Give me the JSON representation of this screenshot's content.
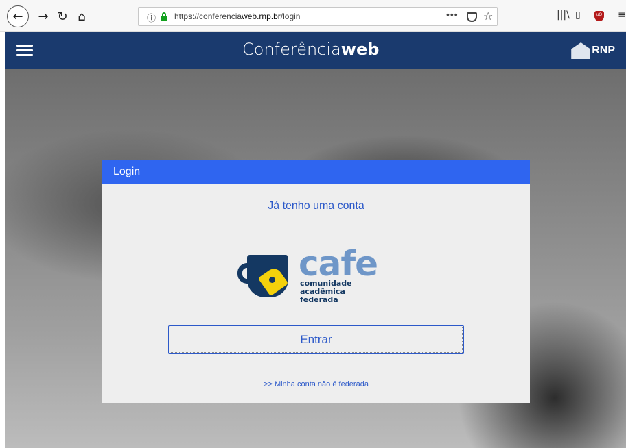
{
  "browser": {
    "url_prefix": "https://conferencia",
    "url_host": "web.rnp.br",
    "url_path": "/login",
    "more_label": "•••"
  },
  "header": {
    "brand_light": "Conferência",
    "brand_bold": "web",
    "org": "RNP",
    "color": "#1a3a6e"
  },
  "login": {
    "title": "Login",
    "subtitle": "Já tenho uma conta",
    "cafe_word": "cafe",
    "cafe_line1": "comunidade",
    "cafe_line2": "acadêmica federada",
    "button": "Entrar",
    "link": ">> Minha conta não é federada",
    "accent": "#2f65f0"
  }
}
